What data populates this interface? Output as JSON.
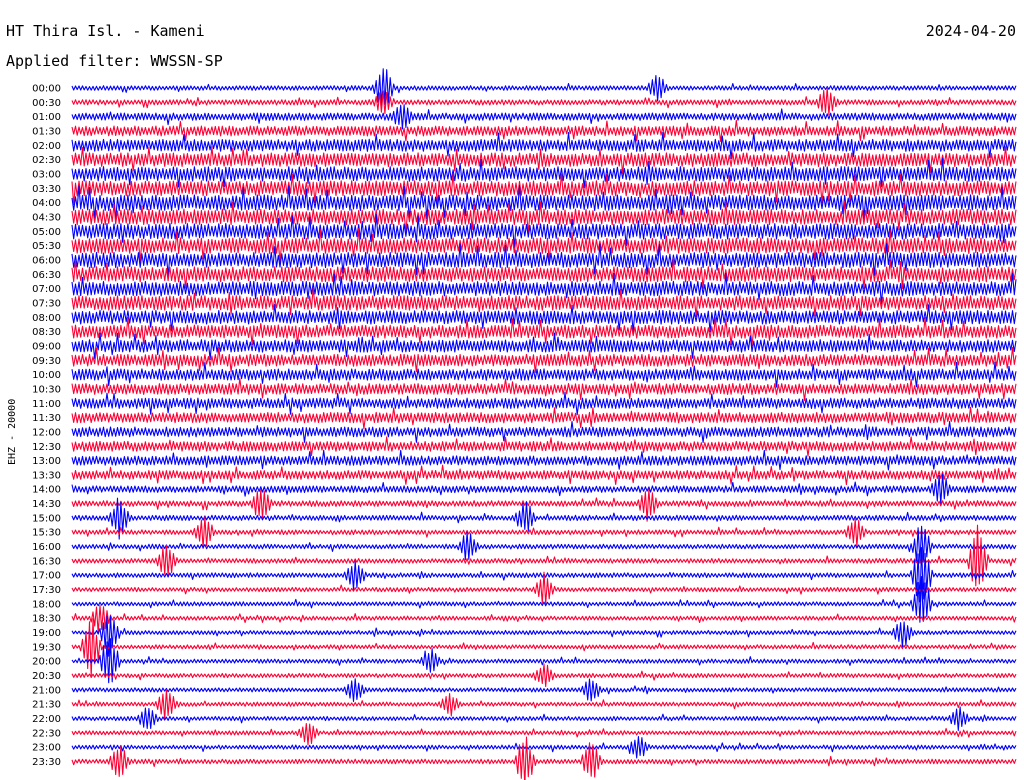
{
  "header": {
    "station": "HT Thira Isl. - Kameni",
    "date": "2024-04-20",
    "filter": "Applied filter: WWSSN-SP"
  },
  "chart_data": {
    "type": "line",
    "title": "HT Thira Isl. - Kameni",
    "subtitle": "Applied filter: WWSSN-SP",
    "date": "2024-04-20",
    "ylabel": "EHZ - 20000",
    "xlabel": "",
    "legend": "none",
    "grid": false,
    "colors": [
      "#0000ff",
      "#ff0033"
    ],
    "rows": [
      {
        "label": "00:00",
        "color": "#0000ff",
        "noise": 0.9,
        "events": [
          {
            "t": 0.33,
            "amp": 3
          },
          {
            "t": 0.62,
            "amp": 1.5
          }
        ]
      },
      {
        "label": "00:30",
        "color": "#ff0033",
        "noise": 1.0,
        "events": [
          {
            "t": 0.33,
            "amp": 1.5
          },
          {
            "t": 0.8,
            "amp": 2
          }
        ]
      },
      {
        "label": "01:00",
        "color": "#0000ff",
        "noise": 1.4,
        "events": [
          {
            "t": 0.35,
            "amp": 1.5
          }
        ]
      },
      {
        "label": "01:30",
        "color": "#ff0033",
        "noise": 1.9,
        "events": []
      },
      {
        "label": "02:00",
        "color": "#0000ff",
        "noise": 2.3,
        "events": []
      },
      {
        "label": "02:30",
        "color": "#ff0033",
        "noise": 2.6,
        "events": []
      },
      {
        "label": "03:00",
        "color": "#0000ff",
        "noise": 2.8,
        "events": []
      },
      {
        "label": "03:30",
        "color": "#ff0033",
        "noise": 2.9,
        "events": []
      },
      {
        "label": "04:00",
        "color": "#0000ff",
        "noise": 3.0,
        "events": []
      },
      {
        "label": "04:30",
        "color": "#ff0033",
        "noise": 3.0,
        "events": []
      },
      {
        "label": "05:00",
        "color": "#0000ff",
        "noise": 3.0,
        "events": []
      },
      {
        "label": "05:30",
        "color": "#ff0033",
        "noise": 3.0,
        "events": []
      },
      {
        "label": "06:00",
        "color": "#0000ff",
        "noise": 2.9,
        "events": []
      },
      {
        "label": "06:30",
        "color": "#ff0033",
        "noise": 2.9,
        "events": []
      },
      {
        "label": "07:00",
        "color": "#0000ff",
        "noise": 2.8,
        "events": []
      },
      {
        "label": "07:30",
        "color": "#ff0033",
        "noise": 2.8,
        "events": []
      },
      {
        "label": "08:00",
        "color": "#0000ff",
        "noise": 2.6,
        "events": []
      },
      {
        "label": "08:30",
        "color": "#ff0033",
        "noise": 2.5,
        "events": []
      },
      {
        "label": "09:00",
        "color": "#0000ff",
        "noise": 2.4,
        "events": []
      },
      {
        "label": "09:30",
        "color": "#ff0033",
        "noise": 2.3,
        "events": []
      },
      {
        "label": "10:00",
        "color": "#0000ff",
        "noise": 2.2,
        "events": []
      },
      {
        "label": "10:30",
        "color": "#ff0033",
        "noise": 2.1,
        "events": []
      },
      {
        "label": "11:00",
        "color": "#0000ff",
        "noise": 2.0,
        "events": []
      },
      {
        "label": "11:30",
        "color": "#ff0033",
        "noise": 2.0,
        "events": []
      },
      {
        "label": "12:00",
        "color": "#0000ff",
        "noise": 1.9,
        "events": []
      },
      {
        "label": "12:30",
        "color": "#ff0033",
        "noise": 1.9,
        "events": []
      },
      {
        "label": "13:00",
        "color": "#0000ff",
        "noise": 1.8,
        "events": []
      },
      {
        "label": "13:30",
        "color": "#ff0033",
        "noise": 1.7,
        "events": []
      },
      {
        "label": "14:00",
        "color": "#0000ff",
        "noise": 1.3,
        "events": [
          {
            "t": 0.92,
            "amp": 2
          }
        ]
      },
      {
        "label": "14:30",
        "color": "#ff0033",
        "noise": 1.1,
        "events": [
          {
            "t": 0.2,
            "amp": 2
          },
          {
            "t": 0.61,
            "amp": 2
          }
        ]
      },
      {
        "label": "15:00",
        "color": "#0000ff",
        "noise": 1.0,
        "events": [
          {
            "t": 0.05,
            "amp": 2.5
          },
          {
            "t": 0.48,
            "amp": 2
          }
        ]
      },
      {
        "label": "15:30",
        "color": "#ff0033",
        "noise": 0.9,
        "events": [
          {
            "t": 0.14,
            "amp": 2
          },
          {
            "t": 0.83,
            "amp": 2
          }
        ]
      },
      {
        "label": "16:00",
        "color": "#0000ff",
        "noise": 0.9,
        "events": [
          {
            "t": 0.42,
            "amp": 2
          },
          {
            "t": 0.9,
            "amp": 3
          }
        ]
      },
      {
        "label": "16:30",
        "color": "#ff0033",
        "noise": 0.9,
        "events": [
          {
            "t": 0.1,
            "amp": 2
          },
          {
            "t": 0.96,
            "amp": 4.5
          }
        ]
      },
      {
        "label": "17:00",
        "color": "#0000ff",
        "noise": 0.9,
        "events": [
          {
            "t": 0.3,
            "amp": 2
          },
          {
            "t": 0.9,
            "amp": 5
          }
        ]
      },
      {
        "label": "17:30",
        "color": "#ff0033",
        "noise": 0.8,
        "events": [
          {
            "t": 0.5,
            "amp": 2
          }
        ]
      },
      {
        "label": "18:00",
        "color": "#0000ff",
        "noise": 0.8,
        "events": [
          {
            "t": 0.9,
            "amp": 3.5
          }
        ]
      },
      {
        "label": "18:30",
        "color": "#ff0033",
        "noise": 0.8,
        "events": [
          {
            "t": 0.03,
            "amp": 2
          }
        ]
      },
      {
        "label": "19:00",
        "color": "#0000ff",
        "noise": 0.8,
        "events": [
          {
            "t": 0.04,
            "amp": 3
          },
          {
            "t": 0.88,
            "amp": 2
          }
        ]
      },
      {
        "label": "19:30",
        "color": "#ff0033",
        "noise": 0.8,
        "events": [
          {
            "t": 0.02,
            "amp": 4
          }
        ]
      },
      {
        "label": "20:00",
        "color": "#0000ff",
        "noise": 0.8,
        "events": [
          {
            "t": 0.04,
            "amp": 3.5
          },
          {
            "t": 0.38,
            "amp": 1.5
          }
        ]
      },
      {
        "label": "20:30",
        "color": "#ff0033",
        "noise": 0.8,
        "events": [
          {
            "t": 0.5,
            "amp": 1.5
          }
        ]
      },
      {
        "label": "21:00",
        "color": "#0000ff",
        "noise": 0.8,
        "events": [
          {
            "t": 0.3,
            "amp": 1.5
          },
          {
            "t": 0.55,
            "amp": 1.5
          }
        ]
      },
      {
        "label": "21:30",
        "color": "#ff0033",
        "noise": 0.8,
        "events": [
          {
            "t": 0.1,
            "amp": 2
          },
          {
            "t": 0.4,
            "amp": 1.5
          }
        ]
      },
      {
        "label": "22:00",
        "color": "#0000ff",
        "noise": 0.8,
        "events": [
          {
            "t": 0.08,
            "amp": 1.5
          },
          {
            "t": 0.94,
            "amp": 1.5
          }
        ]
      },
      {
        "label": "22:30",
        "color": "#ff0033",
        "noise": 0.8,
        "events": [
          {
            "t": 0.25,
            "amp": 1.5
          }
        ]
      },
      {
        "label": "23:00",
        "color": "#0000ff",
        "noise": 0.8,
        "events": [
          {
            "t": 0.6,
            "amp": 1.5
          }
        ]
      },
      {
        "label": "23:30",
        "color": "#ff0033",
        "noise": 0.9,
        "events": [
          {
            "t": 0.05,
            "amp": 2
          },
          {
            "t": 0.48,
            "amp": 3.5
          },
          {
            "t": 0.55,
            "amp": 2.5
          }
        ]
      }
    ]
  }
}
